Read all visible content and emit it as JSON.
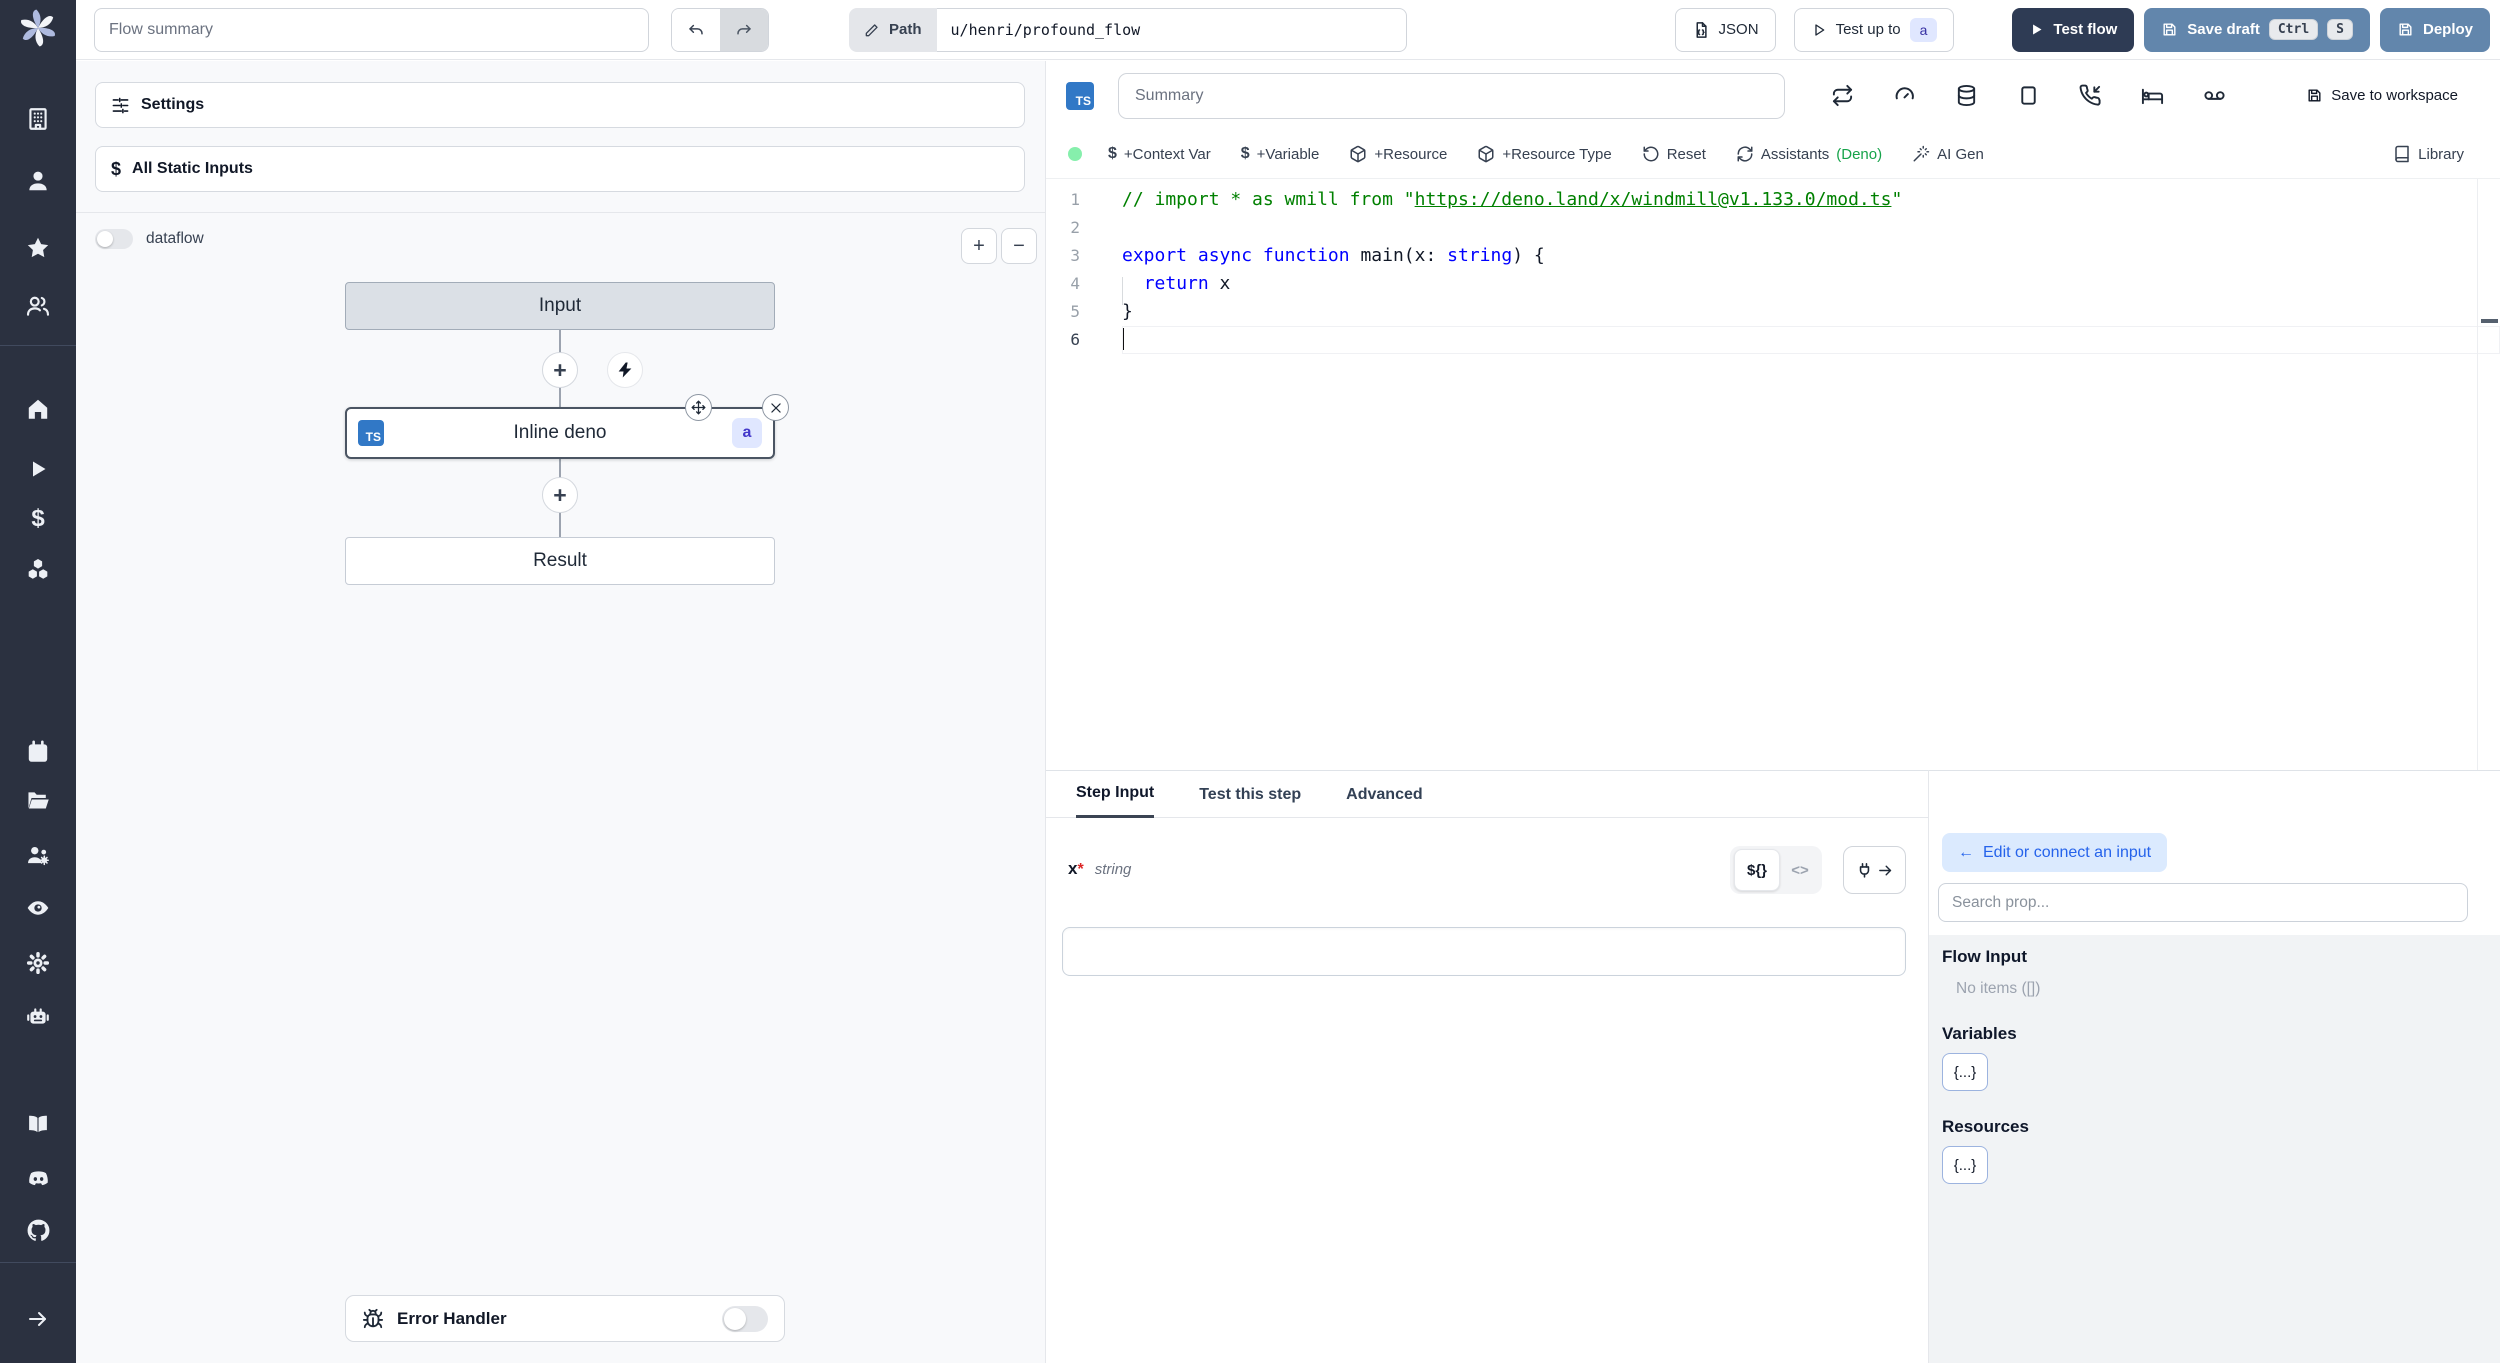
{
  "topbar": {
    "flow_summary_placeholder": "Flow summary",
    "path_label": "Path",
    "path_value": "u/henri/profound_flow",
    "json_label": "JSON",
    "test_up_to_label": "Test up to",
    "test_up_to_step": "a",
    "test_flow_label": "Test flow",
    "save_draft_label": "Save draft",
    "kbd_ctrl": "Ctrl",
    "kbd_s": "S",
    "deploy_label": "Deploy"
  },
  "flow_panel": {
    "settings_label": "Settings",
    "static_inputs_label": "All Static Inputs",
    "static_inputs_icon": "$",
    "dataflow_label": "dataflow",
    "zoom_in": "+",
    "zoom_out": "−",
    "input_node": "Input",
    "step_node": "Inline deno",
    "step_lang": "TS",
    "step_id": "a",
    "result_node": "Result",
    "error_handler_label": "Error Handler"
  },
  "editor": {
    "lang_badge": "TS",
    "summary_placeholder": "Summary",
    "save_to_workspace": "Save to workspace",
    "context_var_icon": "$",
    "add_context_var": "+Context Var",
    "variable_icon": "$",
    "add_variable": "+Variable",
    "add_resource": "+Resource",
    "add_resource_type": "+Resource Type",
    "reset": "Reset",
    "assistants": "Assistants",
    "assistants_lang": "(Deno)",
    "ai_gen": "AI Gen",
    "library": "Library",
    "code": {
      "lines": [
        {
          "n": "1",
          "tokens": [
            {
              "t": "// import * as wmill from \"",
              "s": "com"
            },
            {
              "t": "https://deno.land/x/windmill@v1.133.0/mod.ts",
              "s": "com link"
            },
            {
              "t": "\"",
              "s": "com"
            }
          ]
        },
        {
          "n": "2",
          "tokens": []
        },
        {
          "n": "3",
          "tokens": [
            {
              "t": "export",
              "s": "kw"
            },
            {
              "t": " ",
              "s": "pl"
            },
            {
              "t": "async",
              "s": "kw"
            },
            {
              "t": " ",
              "s": "pl"
            },
            {
              "t": "function",
              "s": "kw"
            },
            {
              "t": " main(x: ",
              "s": "pl"
            },
            {
              "t": "string",
              "s": "kw"
            },
            {
              "t": ") {",
              "s": "pl"
            }
          ]
        },
        {
          "n": "4",
          "tokens": [
            {
              "t": "  ",
              "s": "pl"
            },
            {
              "t": "return",
              "s": "kw"
            },
            {
              "t": " x",
              "s": "pl"
            }
          ]
        },
        {
          "n": "5",
          "tokens": [
            {
              "t": "}",
              "s": "pl"
            }
          ]
        },
        {
          "n": "6",
          "tokens": [],
          "cursor": true,
          "active": true
        }
      ]
    }
  },
  "bottom": {
    "tabs": [
      {
        "label": "Step Input"
      },
      {
        "label": "Test this step"
      },
      {
        "label": "Advanced"
      }
    ],
    "field": {
      "name": "x",
      "required": "*",
      "type": "string"
    },
    "expr_toggle": "${}",
    "code_toggle": "<>",
    "connect": {
      "back_arrow": "←",
      "back_label": "Edit or connect an input",
      "search_placeholder": "Search prop...",
      "flow_input_title": "Flow Input",
      "flow_input_empty": "No items ([])",
      "variables_title": "Variables",
      "variables_button": "{...}",
      "resources_title": "Resources",
      "resources_button": "{...}"
    }
  },
  "colors": {
    "sidebar_bg": "#2b3140",
    "primary_dark_button": "#2e3b54",
    "primary_blue_button": "#6286ac",
    "step_badge_bg": "#e0e7ff",
    "step_badge_text": "#3730a3",
    "link_blue": "#2563eb",
    "back_button_bg": "#dbeafe",
    "deno_green": "#16a34a",
    "status_green": "#86efac",
    "ts_badge_blue": "#3178c6",
    "code_keyword": "#0000ff",
    "code_comment": "#008000",
    "required_red": "#dc2626"
  }
}
